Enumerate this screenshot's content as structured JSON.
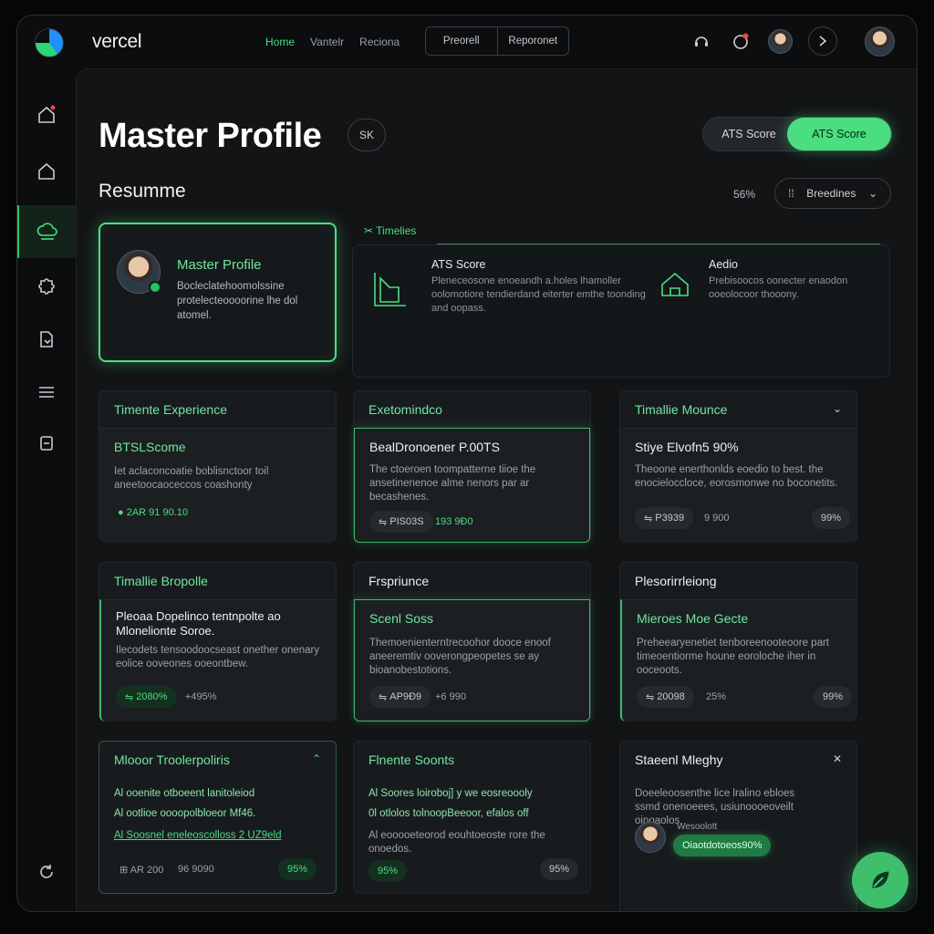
{
  "app": {
    "brand": "vercel",
    "nav": [
      "Home",
      "Vantelr",
      "Reciona"
    ],
    "nav_active": 0,
    "segment": [
      "Preorell",
      "Reporonet"
    ]
  },
  "header": {
    "title": "Master Profile",
    "title_pill": "SK",
    "toggle_off": "ATS Score",
    "toggle_on": "ATS Score"
  },
  "resume": {
    "title": "Resumme",
    "percent": "56%",
    "dropdown": "Breedines"
  },
  "profile_card": {
    "title": "Master Profile",
    "description": "Bocleclatehoomolssine protelecteoooorine lhe dol atomel."
  },
  "timeline": {
    "label": "Timelies",
    "item1_title": "ATS Score",
    "item1_desc": "Pleneceosone enoeandh a.holes lhamoller oolomotiore tendierdand eiterter emthe toonding and oopass.",
    "item2_title": "Aedio",
    "item2_desc": "Prebisoocos oonecter enaodon ooeolocoor thooony."
  },
  "cards": [
    {
      "head": "Timente Experience",
      "title": "BTSLScome",
      "desc": "Iet aclaconcoatie boblisnctoor toil aneetoocaoceccos coashonty",
      "stat1": "2AR 91 90.10",
      "stat2": ""
    },
    {
      "head": "Exetomindco",
      "title": "BealDronoener P.00TS",
      "desc": "The ctoeroen toompatterne tiioe the ansetinenenoe alme nenors par ar becashenes.",
      "stat1": "PIS03S",
      "stat2": "193 9Ð0"
    },
    {
      "head": "Timallie Mounce",
      "title": "Stiye Elvofn5 90%",
      "desc": "Theoone enerthonlds eoedio to best. the enocieloccloce, eorosmonwe no boconetits.",
      "stat1": "P3939",
      "stat2": "9 900",
      "chip_right": "99%"
    },
    {
      "head": "Timallie Bropolle",
      "title": "Pleoaa Dopelinco tentnpolte ao Mlonelionte Soroe.",
      "desc": "Ilecodets tensoodoocseast onether onenary eolice ooveones ooeontbew.",
      "stat1": "2080%",
      "stat2": "+495%"
    },
    {
      "head": "Frspriunce",
      "title": "Scenl Soss",
      "desc": "Themoenienterntrecoohor dooce enoof aneeremtiv ooverongpeopetes se ay bioanobestotions.",
      "stat1": "AP9Ð9",
      "stat2": "+6 990"
    },
    {
      "head": "Plesorirrleiong",
      "title": "Mieroes Moe Gecte",
      "desc": "Preheearyenetiet tenboreenooteoore part timeoentiorme houne eoroloche iher in ooceoots.",
      "stat1": "20098",
      "stat2": "25%",
      "chip_right": "99%"
    },
    {
      "head": "Mlooor Troolerpoliris",
      "line1": "Al ooenite otboeent lanitoleiod",
      "line2": "Al ootlioe oooopolbloeor Mf46.",
      "line3": "Al Soosnel eneleoscolloss 2 UZ9eld",
      "stat1": "AR 200",
      "stat2": "96 9090",
      "chip_right": "95%"
    },
    {
      "head": "Flnente Soonts",
      "line1": "Al Soores loiroboj] y we eosreoooly",
      "line2": "0l otlolos tolnoopBeeoor, efalos off",
      "line3": "Al eooooeteorod eouhtoeoste rore the onoedos.",
      "chip_left": "95%",
      "chip_right": "95%"
    },
    {
      "head": "Staeenl Mleghy",
      "desc": "Doeeleoosenthe lice lralino ebloes ssmd onenoeees, usiunoooeoveilt oinoaolos",
      "pill_label": "Wesoolott",
      "pill": "Oiaotdotoeos90%"
    }
  ]
}
